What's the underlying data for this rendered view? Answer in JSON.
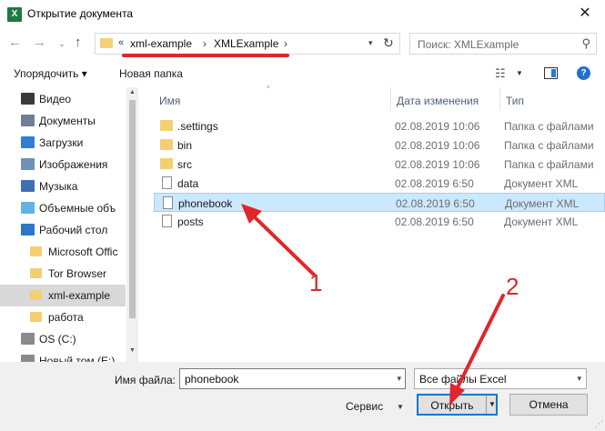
{
  "window": {
    "title": "Открытие документа",
    "app_icon_text": "X"
  },
  "nav": {
    "back": "←",
    "forward": "→",
    "recent": "⌄",
    "up": "↑",
    "address_prefix": "«",
    "address": [
      "xml-example",
      "XMLExample"
    ],
    "address_sep": "›",
    "refresh": "↻",
    "search_placeholder": "Поиск: XMLExample"
  },
  "toolbar": {
    "organize": "Упорядочить ▾",
    "new_folder": "Новая папка",
    "help": "?"
  },
  "sidebar": {
    "items": [
      {
        "label": "Видео",
        "icon": "video-icon",
        "color": "#3a3a3a"
      },
      {
        "label": "Документы",
        "icon": "documents-icon",
        "color": "#6f7f93"
      },
      {
        "label": "Загрузки",
        "icon": "downloads-icon",
        "color": "#2f7fd6"
      },
      {
        "label": "Изображения",
        "icon": "pictures-icon",
        "color": "#6f91b5"
      },
      {
        "label": "Музыка",
        "icon": "music-icon",
        "color": "#3e6fb3"
      },
      {
        "label": "Объемные объ",
        "icon": "3d-objects-icon",
        "color": "#5fb3e6"
      },
      {
        "label": "Рабочий стол",
        "icon": "desktop-icon",
        "color": "#2a79c8"
      },
      {
        "label": "Microsoft Offic",
        "icon": "folder-icon",
        "color": "#f3cf72"
      },
      {
        "label": "Tor Browser",
        "icon": "folder-icon",
        "color": "#f3cf72"
      },
      {
        "label": "xml-example",
        "icon": "folder-icon",
        "color": "#f3cf72"
      },
      {
        "label": "работа",
        "icon": "folder-icon",
        "color": "#f3cf72"
      },
      {
        "label": "OS (C:)",
        "icon": "drive-icon",
        "color": "#8a8a8a"
      },
      {
        "label": "Новый том (E:)",
        "icon": "drive-icon",
        "color": "#8a8a8a"
      }
    ],
    "selected_index": 9
  },
  "columns": {
    "name": "Имя",
    "date": "Дата изменения",
    "type": "Тип"
  },
  "files": [
    {
      "name": ".settings",
      "date": "02.08.2019 10:06",
      "type": "Папка с файлами",
      "kind": "folder"
    },
    {
      "name": "bin",
      "date": "02.08.2019 10:06",
      "type": "Папка с файлами",
      "kind": "folder"
    },
    {
      "name": "src",
      "date": "02.08.2019 10:06",
      "type": "Папка с файлами",
      "kind": "folder"
    },
    {
      "name": "data",
      "date": "02.08.2019 6:50",
      "type": "Документ XML",
      "kind": "file"
    },
    {
      "name": "phonebook",
      "date": "02.08.2019 6:50",
      "type": "Документ XML",
      "kind": "file"
    },
    {
      "name": "posts",
      "date": "02.08.2019 6:50",
      "type": "Документ XML",
      "kind": "file"
    }
  ],
  "selected_file_index": 4,
  "bottom": {
    "filename_label": "Имя файла:",
    "filename_value": "phonebook",
    "filter_value": "Все файлы Excel",
    "service": "Сервис",
    "open": "Открыть",
    "cancel": "Отмена"
  },
  "annotations": {
    "marker1": "1",
    "marker2": "2",
    "color": "#e0262b"
  }
}
